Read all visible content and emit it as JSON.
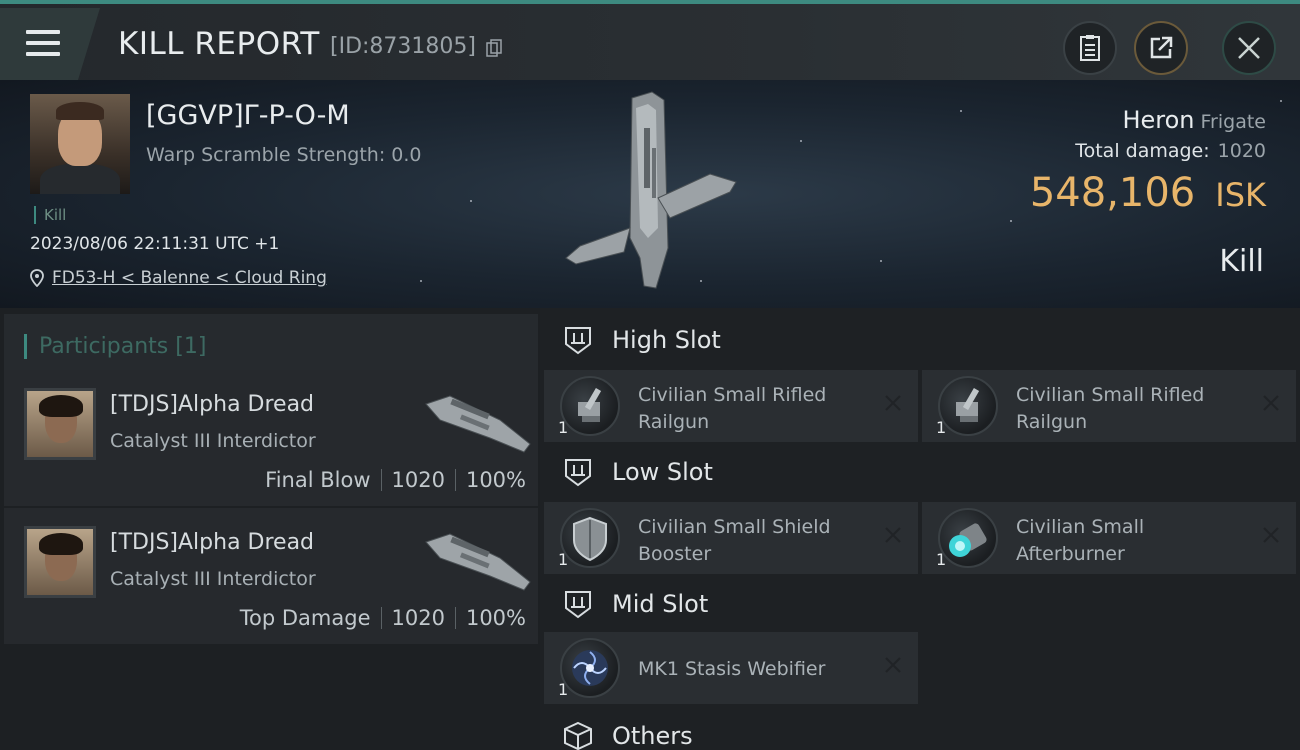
{
  "header": {
    "title": "KILL REPORT",
    "report_id": "[ID:8731805]"
  },
  "victim": {
    "name": "[GGVP]Γ-P-O-M",
    "warp_scramble": "Warp Scramble Strength: 0.0",
    "tag": "Kill",
    "timestamp": "2023/08/06 22:11:31 UTC +1",
    "location": "FD53-H < Balenne < Cloud Ring",
    "ship": "Heron",
    "ship_class": "Frigate",
    "total_damage_label": "Total damage:",
    "total_damage": "1020",
    "isk_value": "548,106",
    "isk_unit": "ISK",
    "result": "Kill"
  },
  "participants": {
    "title": "Participants",
    "count": "[1]",
    "rows": [
      {
        "name": "[TDJS]Alpha Dread",
        "ship": "Catalyst III Interdictor",
        "role": "Final Blow",
        "damage": "1020",
        "percent": "100%"
      },
      {
        "name": "[TDJS]Alpha Dread",
        "ship": "Catalyst III Interdictor",
        "role": "Top Damage",
        "damage": "1020",
        "percent": "100%"
      }
    ]
  },
  "fittings": {
    "high_slot": {
      "label": "High Slot",
      "modules": [
        {
          "name": "Civilian Small Rifled Railgun",
          "qty": "1"
        },
        {
          "name": "Civilian Small Rifled Railgun",
          "qty": "1"
        }
      ]
    },
    "low_slot": {
      "label": "Low Slot",
      "modules": [
        {
          "name": "Civilian Small Shield Booster",
          "qty": "1"
        },
        {
          "name": "Civilian Small Afterburner",
          "qty": "1"
        }
      ]
    },
    "mid_slot": {
      "label": "Mid Slot",
      "modules": [
        {
          "name": "MK1 Stasis Webifier",
          "qty": "1"
        }
      ]
    },
    "others": {
      "label": "Others"
    }
  },
  "colors": {
    "accent_teal": "#3d8a80",
    "isk_gold": "#e8b56a"
  }
}
